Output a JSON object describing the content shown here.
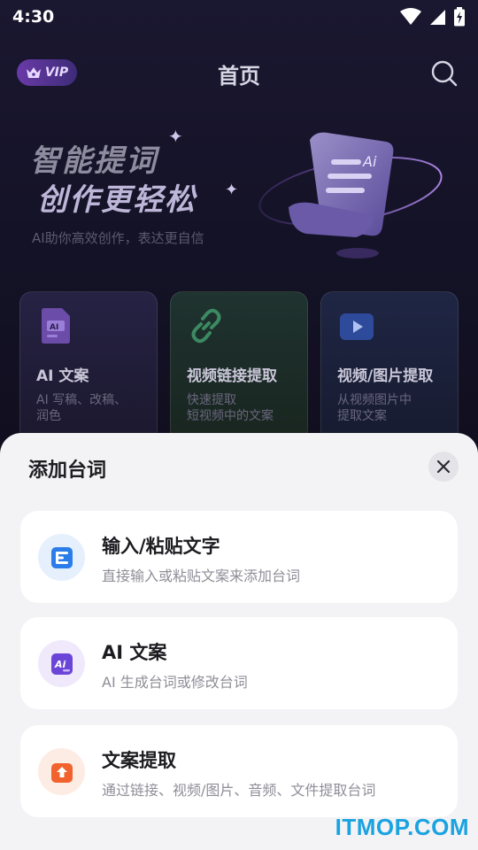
{
  "status_bar": {
    "time": "4:30"
  },
  "app_bar": {
    "vip_label": "VIP",
    "title": "首页"
  },
  "hero": {
    "line1": "智能提词",
    "line2": "创作更轻松",
    "subtitle": "AI助你高效创作，表达更自信",
    "art_label": "Ai"
  },
  "cards": [
    {
      "title": "AI 文案",
      "desc": "AI 写稿、改稿、\n润色",
      "icon": "ai-document-icon"
    },
    {
      "title": "视频链接提取",
      "desc": "快速提取\n短视频中的文案",
      "icon": "link-icon"
    },
    {
      "title": "视频/图片提取",
      "desc": "从视频图片中\n提取文案",
      "icon": "video-play-icon"
    }
  ],
  "sheet": {
    "title": "添加台词",
    "options": [
      {
        "title": "输入/粘贴文字",
        "desc": "直接输入或粘贴文案来添加台词",
        "icon": "text-input-icon",
        "color": "#2b7de9"
      },
      {
        "title": "AI 文案",
        "desc": "AI 生成台词或修改台词",
        "icon": "ai-icon",
        "color": "#6b45d8"
      },
      {
        "title": "文案提取",
        "desc": "通过链接、视频/图片、音频、文件提取台词",
        "icon": "extract-upload-icon",
        "color": "#f2622e"
      }
    ]
  },
  "watermark": "ITMOP.COM",
  "colors": {
    "sheet_bg": "#f3f3f6",
    "accent_purple": "#6b45d8"
  }
}
